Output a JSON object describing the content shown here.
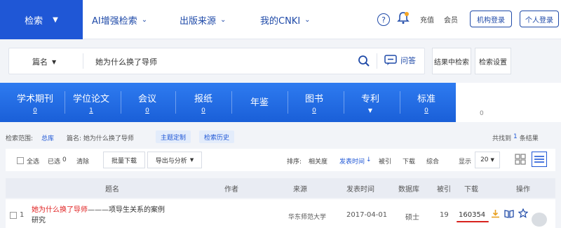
{
  "nav": {
    "search_label": "检索",
    "ai_label": "AI增强检索",
    "source_label": "出版来源",
    "mycnki_label": "我的CNKI",
    "help_icon_glyph": "?",
    "recharge": "充值",
    "member": "会员",
    "org_login": "机构登录",
    "personal_login": "个人登录"
  },
  "search": {
    "field": "篇名",
    "query": "她为什么换了导师",
    "qa_label": "问答",
    "search_in_results": "结果中检索",
    "settings": "检索设置"
  },
  "categories": [
    {
      "label": "学术期刊",
      "count": "0"
    },
    {
      "label": "学位论文",
      "count": "1"
    },
    {
      "label": "会议",
      "count": "0"
    },
    {
      "label": "报纸",
      "count": "0"
    },
    {
      "label": "年鉴",
      "count": ""
    },
    {
      "label": "图书",
      "count": "0"
    },
    {
      "label": "专利",
      "count": ""
    },
    {
      "label": "标准",
      "count": "0"
    }
  ],
  "other_count": "0",
  "filter": {
    "scope_label": "检索范围:",
    "scope_value": "总库",
    "condition": "篇名: 她为什么换了导师",
    "topic_btn": "主题定制",
    "history_btn": "检索历史",
    "found": "共找到",
    "found_count": "1",
    "found_unit": "条结果"
  },
  "toolbar": {
    "select_all": "全选",
    "selected": "已选",
    "selected_count": "0",
    "clear": "清除",
    "batch_download": "批量下载",
    "export": "导出与分析",
    "sort_label": "排序:",
    "sort_relevance": "相关度",
    "sort_date": "发表时间",
    "sort_cited": "被引",
    "sort_download": "下载",
    "sort_composite": "综合",
    "show_label": "显示",
    "page_size": "20"
  },
  "table": {
    "headers": [
      "题名",
      "作者",
      "来源",
      "发表时间",
      "数据库",
      "被引",
      "下载",
      "操作"
    ],
    "rows": [
      {
        "index": "1",
        "title_highlight": "她为什么换了导师",
        "title_rest": "———项导生关系的案例",
        "title_line2": "研究",
        "author": "",
        "source": "华东师范大学",
        "date": "2017-04-01",
        "db": "硕士",
        "cited": "19",
        "downloads": "160354"
      }
    ]
  },
  "colors": {
    "primary": "#1f57d6",
    "highlight_red": "#e02020",
    "underline_red": "#d8231e"
  }
}
